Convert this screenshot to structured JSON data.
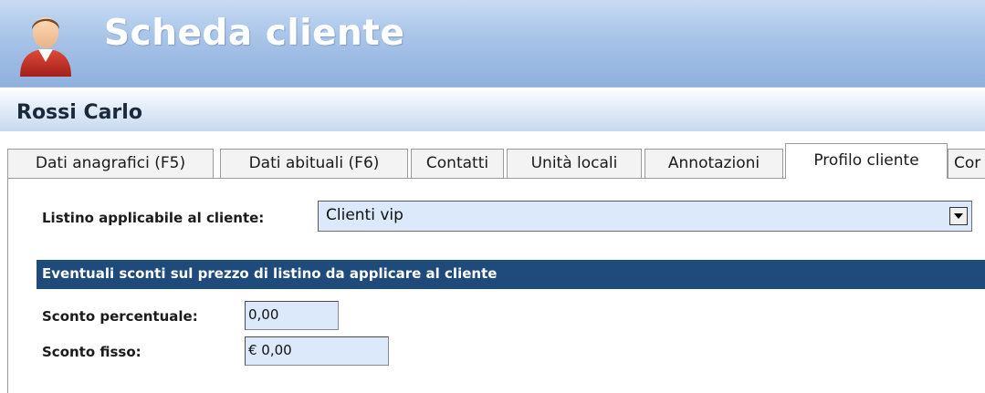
{
  "header": {
    "title": "Scheda cliente",
    "icon": "user-icon"
  },
  "customer": {
    "name": "Rossi Carlo"
  },
  "tabs": [
    {
      "label": "Dati anagrafici (F5)",
      "active": false
    },
    {
      "label": "Dati abituali (F6)",
      "active": false
    },
    {
      "label": "Contatti",
      "active": false
    },
    {
      "label": "Unità locali",
      "active": false
    },
    {
      "label": "Annotazioni",
      "active": false
    },
    {
      "label": "Profilo cliente",
      "active": true
    },
    {
      "label": "Cor",
      "active": false
    }
  ],
  "profile": {
    "price_list_label": "Listino applicabile al cliente:",
    "price_list_value": "Clienti vip",
    "discount_section_title": "Eventuali sconti sul prezzo di listino da applicare al cliente",
    "percent_discount_label": "Sconto percentuale:",
    "percent_discount_value": "0,00",
    "fixed_discount_label": "Sconto fisso:",
    "fixed_discount_value": "€ 0,00"
  },
  "colors": {
    "header_top": "#c8dbf3",
    "header_bottom": "#8fb0dd",
    "section_bar": "#1f4a7c",
    "field_bg": "#dbe9fb"
  }
}
